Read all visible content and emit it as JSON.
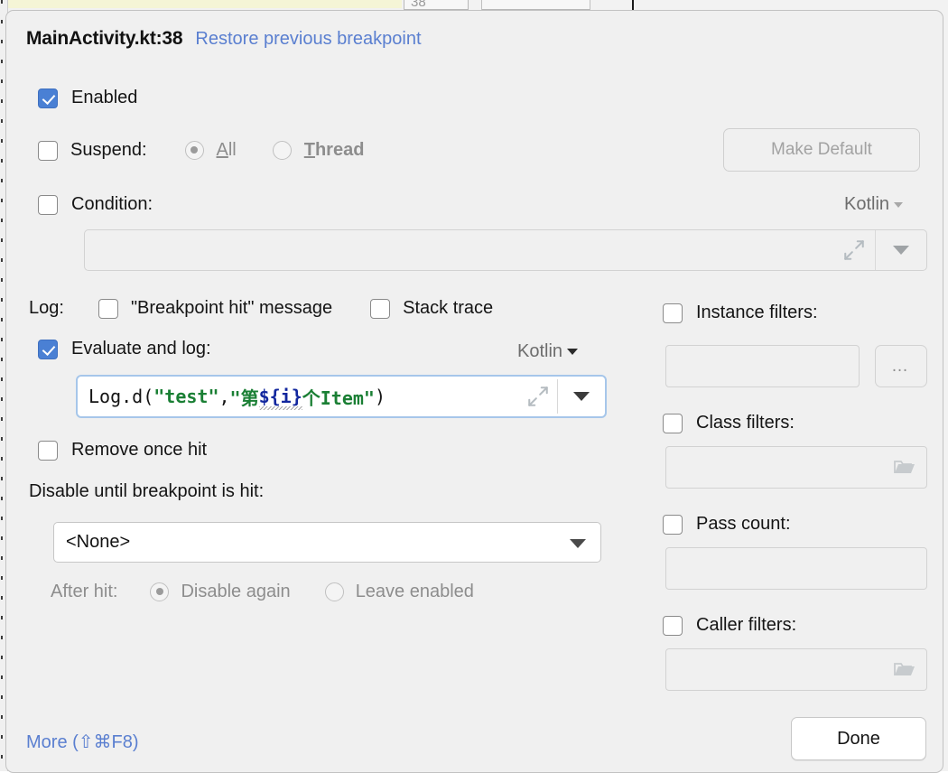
{
  "editor_backdrop": {
    "line_number": "38",
    "highlight_color": "#f5f5d6"
  },
  "dialog": {
    "title": "MainActivity.kt:38",
    "restore_link": "Restore previous breakpoint",
    "enabled": {
      "label": "Enabled",
      "checked": true
    },
    "suspend": {
      "label": "Suspend:",
      "checked": false,
      "options": [
        {
          "label": "All",
          "mnemonic": "A",
          "rest": "ll",
          "selected": true,
          "disabled": true
        },
        {
          "label": "Thread",
          "mnemonic": "T",
          "rest": "hread",
          "selected": false,
          "disabled": true
        }
      ],
      "make_default_button": "Make Default"
    },
    "condition": {
      "label": "Condition:",
      "checked": false,
      "language": "Kotlin",
      "value": "",
      "expand_icon": "expand-diagonal-icon",
      "dropdown_icon": "chevron-down-icon"
    },
    "log": {
      "label": "Log:",
      "breakpoint_hit_message": {
        "label": "\"Breakpoint hit\" message",
        "checked": false
      },
      "stack_trace": {
        "label": "Stack trace",
        "checked": false
      },
      "evaluate_and_log": {
        "label": "Evaluate and log:",
        "checked": true,
        "language": "Kotlin",
        "code": {
          "full_text": "Log.d(\"test\",\"第 ${i} 个Item\")",
          "tokens": [
            {
              "text": "Log.d(",
              "type": "plain"
            },
            {
              "text": "\"test\"",
              "type": "string"
            },
            {
              "text": ",",
              "type": "plain"
            },
            {
              "text": "\"第 ",
              "type": "string"
            },
            {
              "text": "${i}",
              "type": "template"
            },
            {
              "text": " 个Item\"",
              "type": "string"
            },
            {
              "text": ")",
              "type": "plain"
            }
          ]
        }
      }
    },
    "remove_once_hit": {
      "label": "Remove once hit",
      "checked": false
    },
    "disable_until": {
      "label": "Disable until breakpoint is hit:",
      "selected_value": "<None>",
      "options": [
        "<None>"
      ]
    },
    "after_hit": {
      "label": "After hit:",
      "options": [
        {
          "label": "Disable again",
          "selected": true,
          "disabled": true
        },
        {
          "label": "Leave enabled",
          "selected": false,
          "disabled": true
        }
      ]
    },
    "filters": {
      "instance": {
        "label": "Instance filters:",
        "checked": false,
        "value": "",
        "button": "…"
      },
      "class": {
        "label": "Class filters:",
        "checked": false,
        "value": "",
        "icon": "folder-icon"
      },
      "pass_count": {
        "label": "Pass count:",
        "checked": false,
        "value": ""
      },
      "caller": {
        "label": "Caller filters:",
        "checked": false,
        "value": "",
        "icon": "folder-icon"
      }
    },
    "footer": {
      "more_link": "More (⇧⌘F8)",
      "done_button": "Done"
    },
    "colors": {
      "link": "#5a7fd0",
      "checkbox_accent": "#4a80d4",
      "dialog_bg": "#f0f0f0",
      "code_string": "#1a7f34",
      "code_template": "#12279e",
      "focus_ring": "#a6c6ea"
    }
  }
}
